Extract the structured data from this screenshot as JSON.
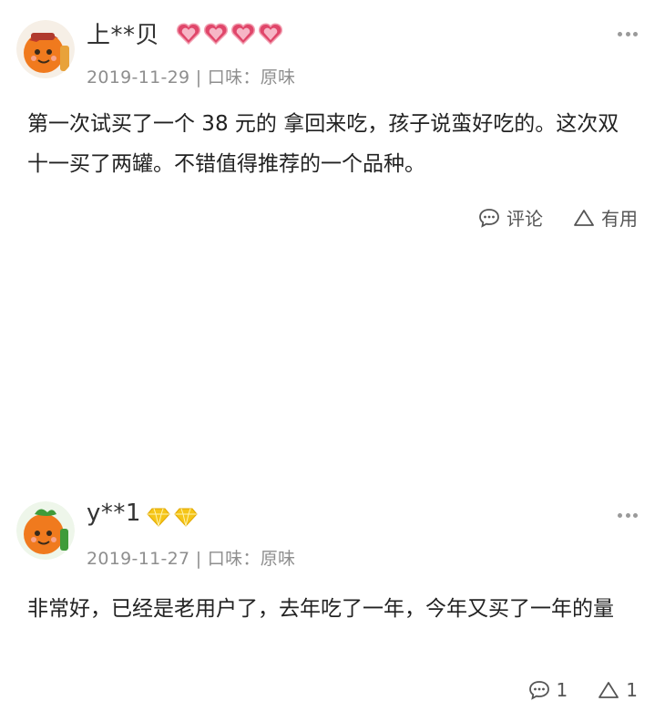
{
  "reviews": [
    {
      "username": "上**贝",
      "badge_icon": "heart-gem-icon",
      "badge_count": 4,
      "date": "2019-11-29",
      "flavor": "| 口味：原味",
      "content": "第一次试买了一个 38 元的 拿回来吃，孩子说蛮好吃的。这次双十一买了两罐。不错值得推荐的一个品种。",
      "comment_label": "评论",
      "useful_label": "有用"
    },
    {
      "username": "y**1",
      "badge_icon": "gold-diamond-icon",
      "badge_count": 2,
      "date": "2019-11-27",
      "flavor": "| 口味：原味",
      "content": "非常好，已经是老用户了，去年吃了一年，今年又买了一年的量",
      "comment_label": "1",
      "useful_label": "1"
    }
  ],
  "colors": {
    "heart_badge": "#e0466a",
    "gold_badge": "#f5c518",
    "meta_text": "#8e8e8e",
    "avatar_orange": "#f07a1e"
  }
}
